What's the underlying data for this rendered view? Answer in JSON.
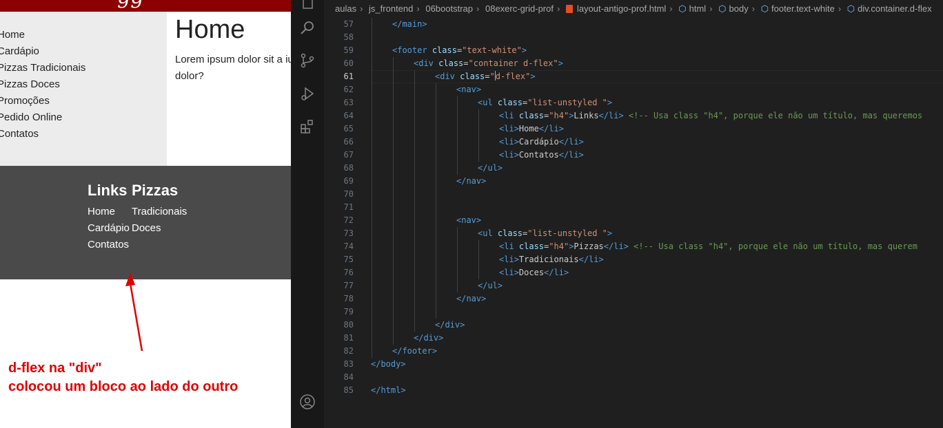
{
  "preview": {
    "topbar_glyph": "gg",
    "sidenav_items": [
      "Home",
      "Cardápio",
      "Pizzas Tradicionais",
      "Pizzas Doces",
      "Promoções",
      "Pedido Online",
      "Contatos"
    ],
    "main_title": "Home",
    "main_text": "Lorem ipsum dolor sit a iure quam itaque dolor?",
    "footer_links": [
      "Links",
      "Home",
      "Cardápio",
      "Contatos"
    ],
    "footer_pizzas": [
      "Pizzas",
      "Tradicionais",
      "Doces"
    ],
    "annotation_line1": "d-flex na \"div\"",
    "annotation_line2": "colocou um bloco ao lado do outro",
    "colors": {
      "topbar": "#8b0000",
      "sidenav_bg": "#ececec",
      "footer_bg": "#4a4a4a",
      "annotation": "#e00000"
    }
  },
  "editor": {
    "activity_icons": [
      "files-icon",
      "search-icon",
      "source-control-icon",
      "run-debug-icon",
      "extensions-icon",
      "account-icon"
    ],
    "breadcrumb": [
      "aulas",
      "js_frontend",
      "06bootstrap",
      "08exerc-grid-prof",
      "layout-antigo-prof.html",
      "html",
      "body",
      "footer.text-white",
      "div.container.d-flex"
    ],
    "active_line": 61,
    "lines": [
      {
        "n": "57",
        "indent": 1,
        "tokens": [
          [
            "t",
            "</"
          ],
          [
            "g",
            "main"
          ],
          [
            "t",
            ">"
          ]
        ]
      },
      {
        "n": "58",
        "indent": 0,
        "tokens": []
      },
      {
        "n": "59",
        "indent": 1,
        "tokens": [
          [
            "t",
            "<"
          ],
          [
            "g",
            "footer"
          ],
          [
            "a",
            " class"
          ],
          [
            "e",
            "="
          ],
          [
            "s",
            "\"text-white\""
          ],
          [
            "t",
            ">"
          ]
        ]
      },
      {
        "n": "60",
        "indent": 2,
        "tokens": [
          [
            "t",
            "<"
          ],
          [
            "g",
            "div"
          ],
          [
            "a",
            " class"
          ],
          [
            "e",
            "="
          ],
          [
            "s",
            "\"container d-flex\""
          ],
          [
            "t",
            ">"
          ]
        ]
      },
      {
        "n": "61",
        "indent": 3,
        "tokens": [
          [
            "t",
            "<"
          ],
          [
            "g",
            "div"
          ],
          [
            "a",
            " class"
          ],
          [
            "e",
            "="
          ],
          [
            "s",
            "\""
          ],
          [
            "c",
            ""
          ],
          [
            "s",
            "d-flex\""
          ],
          [
            "t",
            ">"
          ]
        ]
      },
      {
        "n": "62",
        "indent": 4,
        "tokens": [
          [
            "t",
            "<"
          ],
          [
            "g",
            "nav"
          ],
          [
            "t",
            ">"
          ]
        ]
      },
      {
        "n": "63",
        "indent": 5,
        "tokens": [
          [
            "t",
            "<"
          ],
          [
            "g",
            "ul"
          ],
          [
            "a",
            " class"
          ],
          [
            "e",
            "="
          ],
          [
            "s",
            "\"list-unstyled \""
          ],
          [
            "t",
            ">"
          ]
        ]
      },
      {
        "n": "64",
        "indent": 6,
        "tokens": [
          [
            "t",
            "<"
          ],
          [
            "g",
            "li"
          ],
          [
            "a",
            " class"
          ],
          [
            "e",
            "="
          ],
          [
            "s",
            "\"h4\""
          ],
          [
            "t",
            ">"
          ],
          [
            "x",
            "Links"
          ],
          [
            "t",
            "</"
          ],
          [
            "g",
            "li"
          ],
          [
            "t",
            "> "
          ],
          [
            "m",
            "<!-- Usa class \"h4\", porque ele não um título, mas queremos"
          ]
        ]
      },
      {
        "n": "65",
        "indent": 6,
        "tokens": [
          [
            "t",
            "<"
          ],
          [
            "g",
            "li"
          ],
          [
            "t",
            ">"
          ],
          [
            "x",
            "Home"
          ],
          [
            "t",
            "</"
          ],
          [
            "g",
            "li"
          ],
          [
            "t",
            ">"
          ]
        ]
      },
      {
        "n": "66",
        "indent": 6,
        "tokens": [
          [
            "t",
            "<"
          ],
          [
            "g",
            "li"
          ],
          [
            "t",
            ">"
          ],
          [
            "x",
            "Cardápio"
          ],
          [
            "t",
            "</"
          ],
          [
            "g",
            "li"
          ],
          [
            "t",
            ">"
          ]
        ]
      },
      {
        "n": "67",
        "indent": 6,
        "tokens": [
          [
            "t",
            "<"
          ],
          [
            "g",
            "li"
          ],
          [
            "t",
            ">"
          ],
          [
            "x",
            "Contatos"
          ],
          [
            "t",
            "</"
          ],
          [
            "g",
            "li"
          ],
          [
            "t",
            ">"
          ]
        ]
      },
      {
        "n": "68",
        "indent": 5,
        "tokens": [
          [
            "t",
            "</"
          ],
          [
            "g",
            "ul"
          ],
          [
            "t",
            ">"
          ]
        ]
      },
      {
        "n": "69",
        "indent": 4,
        "tokens": [
          [
            "t",
            "</"
          ],
          [
            "g",
            "nav"
          ],
          [
            "t",
            ">"
          ]
        ]
      },
      {
        "n": "70",
        "indent": 0,
        "tokens": []
      },
      {
        "n": "71",
        "indent": 0,
        "tokens": []
      },
      {
        "n": "72",
        "indent": 4,
        "tokens": [
          [
            "t",
            "<"
          ],
          [
            "g",
            "nav"
          ],
          [
            "t",
            ">"
          ]
        ]
      },
      {
        "n": "73",
        "indent": 5,
        "tokens": [
          [
            "t",
            "<"
          ],
          [
            "g",
            "ul"
          ],
          [
            "a",
            " class"
          ],
          [
            "e",
            "="
          ],
          [
            "s",
            "\"list-unstyled \""
          ],
          [
            "t",
            ">"
          ]
        ]
      },
      {
        "n": "74",
        "indent": 6,
        "tokens": [
          [
            "t",
            "<"
          ],
          [
            "g",
            "li"
          ],
          [
            "a",
            " class"
          ],
          [
            "e",
            "="
          ],
          [
            "s",
            "\"h4\""
          ],
          [
            "t",
            ">"
          ],
          [
            "x",
            "Pizzas"
          ],
          [
            "t",
            "</"
          ],
          [
            "g",
            "li"
          ],
          [
            "t",
            "> "
          ],
          [
            "m",
            "<!-- Usa class \"h4\", porque ele não um título, mas querem"
          ]
        ]
      },
      {
        "n": "75",
        "indent": 6,
        "tokens": [
          [
            "t",
            "<"
          ],
          [
            "g",
            "li"
          ],
          [
            "t",
            ">"
          ],
          [
            "x",
            "Tradicionais"
          ],
          [
            "t",
            "</"
          ],
          [
            "g",
            "li"
          ],
          [
            "t",
            ">"
          ]
        ]
      },
      {
        "n": "76",
        "indent": 6,
        "tokens": [
          [
            "t",
            "<"
          ],
          [
            "g",
            "li"
          ],
          [
            "t",
            ">"
          ],
          [
            "x",
            "Doces"
          ],
          [
            "t",
            "</"
          ],
          [
            "g",
            "li"
          ],
          [
            "t",
            ">"
          ]
        ]
      },
      {
        "n": "77",
        "indent": 5,
        "tokens": [
          [
            "t",
            "</"
          ],
          [
            "g",
            "ul"
          ],
          [
            "t",
            ">"
          ]
        ]
      },
      {
        "n": "78",
        "indent": 4,
        "tokens": [
          [
            "t",
            "</"
          ],
          [
            "g",
            "nav"
          ],
          [
            "t",
            ">"
          ]
        ]
      },
      {
        "n": "79",
        "indent": 0,
        "tokens": []
      },
      {
        "n": "80",
        "indent": 3,
        "tokens": [
          [
            "t",
            "</"
          ],
          [
            "g",
            "div"
          ],
          [
            "t",
            ">"
          ]
        ]
      },
      {
        "n": "81",
        "indent": 2,
        "tokens": [
          [
            "t",
            "</"
          ],
          [
            "g",
            "div"
          ],
          [
            "t",
            ">"
          ]
        ]
      },
      {
        "n": "82",
        "indent": 1,
        "tokens": [
          [
            "t",
            "</"
          ],
          [
            "g",
            "footer"
          ],
          [
            "t",
            ">"
          ]
        ]
      },
      {
        "n": "83",
        "indent": 0,
        "tokens": [
          [
            "t",
            "</"
          ],
          [
            "g",
            "body"
          ],
          [
            "t",
            ">"
          ]
        ]
      },
      {
        "n": "84",
        "indent": 0,
        "tokens": []
      },
      {
        "n": "85",
        "indent": 0,
        "tokens": [
          [
            "t",
            "</"
          ],
          [
            "g",
            "html"
          ],
          [
            "t",
            ">"
          ]
        ]
      }
    ]
  }
}
